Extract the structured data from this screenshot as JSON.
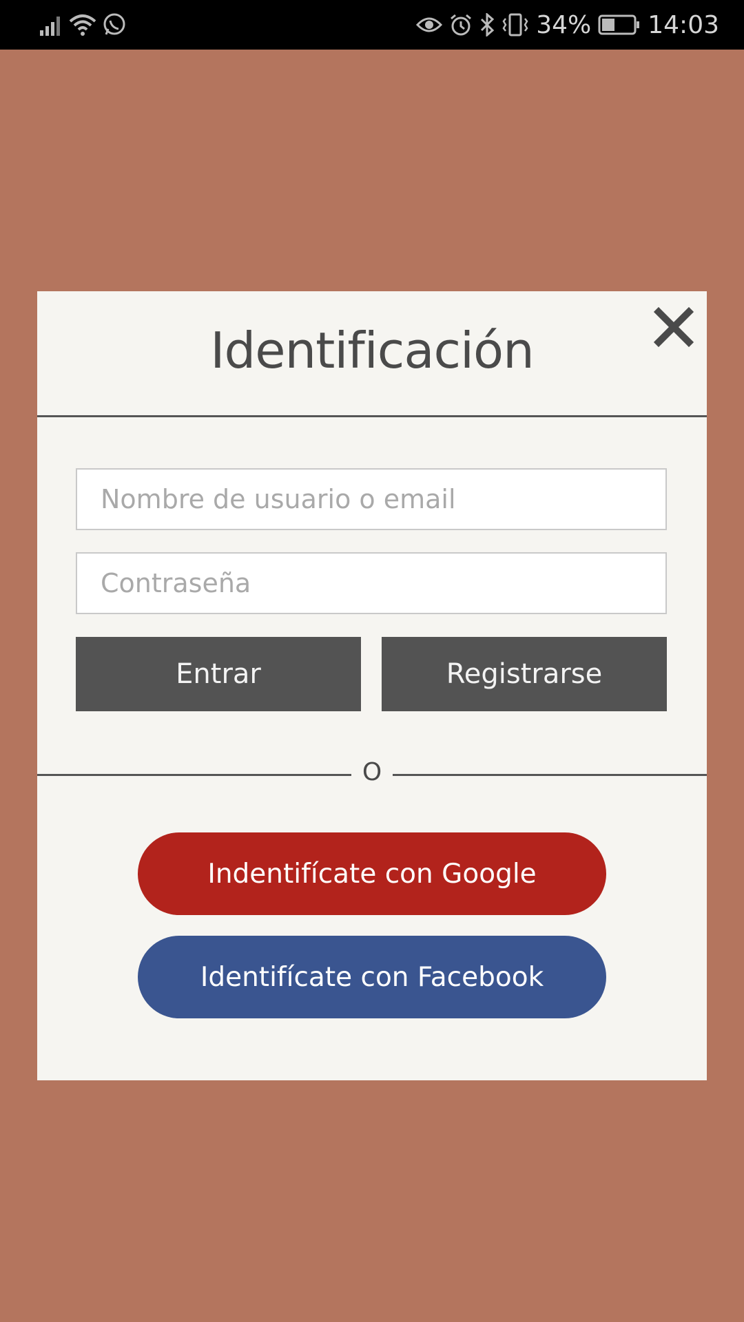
{
  "statusbar": {
    "battery": "34%",
    "time": "14:03"
  },
  "modal": {
    "title": "Identificación",
    "username_placeholder": "Nombre de usuario o email",
    "password_placeholder": "Contraseña",
    "login_label": "Entrar",
    "register_label": "Registrarse",
    "divider_text": "O",
    "google_label": "Indentifícate con Google",
    "facebook_label": "Identifícate con Facebook"
  },
  "colors": {
    "background": "#b4755e",
    "modal_bg": "#f6f5f1",
    "dark_button": "#535353",
    "google": "#b2231c",
    "facebook": "#3a5590"
  },
  "icons": [
    "signal-icon",
    "wifi-icon",
    "whatsapp-icon",
    "eye-icon",
    "alarm-icon",
    "bluetooth-icon",
    "vibrate-icon",
    "battery-icon",
    "close-icon"
  ]
}
